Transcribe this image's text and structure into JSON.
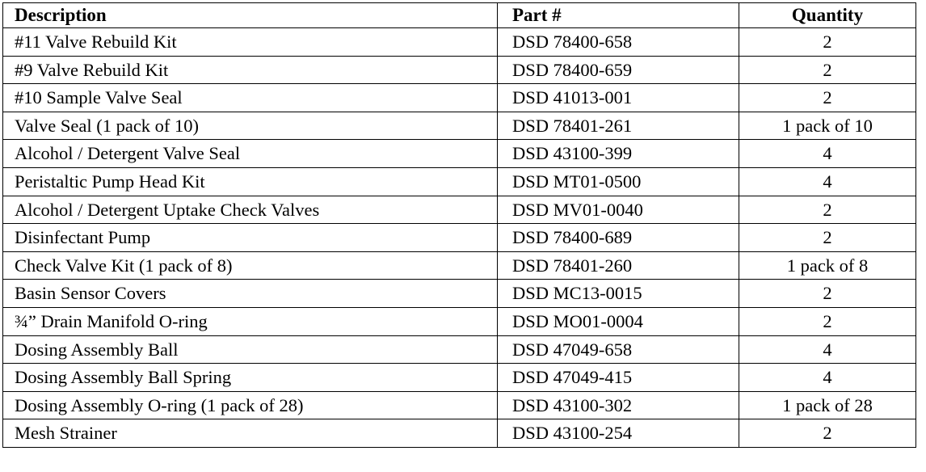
{
  "table": {
    "columns": [
      {
        "key": "description",
        "label": "Description",
        "align": "left"
      },
      {
        "key": "part_number",
        "label": "Part #",
        "align": "left"
      },
      {
        "key": "quantity",
        "label": "Quantity",
        "align": "center"
      }
    ],
    "rows": [
      {
        "description": "#11 Valve Rebuild Kit",
        "part_number": "DSD 78400-658",
        "quantity": "2"
      },
      {
        "description": "#9 Valve Rebuild Kit",
        "part_number": "DSD 78400-659",
        "quantity": "2"
      },
      {
        "description": "#10 Sample Valve Seal",
        "part_number": "DSD 41013-001",
        "quantity": "2"
      },
      {
        "description": "Valve Seal (1 pack of 10)",
        "part_number": "DSD 78401-261",
        "quantity": "1 pack of 10"
      },
      {
        "description": "Alcohol / Detergent Valve Seal",
        "part_number": "DSD 43100-399",
        "quantity": "4"
      },
      {
        "description": "Peristaltic Pump Head Kit",
        "part_number": "DSD MT01-0500",
        "quantity": "4"
      },
      {
        "description": "Alcohol / Detergent Uptake Check Valves",
        "part_number": "DSD MV01-0040",
        "quantity": "2"
      },
      {
        "description": "Disinfectant Pump",
        "part_number": "DSD 78400-689",
        "quantity": "2"
      },
      {
        "description": "Check Valve Kit (1 pack of 8)",
        "part_number": "DSD 78401-260",
        "quantity": "1 pack of 8"
      },
      {
        "description": "Basin Sensor Covers",
        "part_number": "DSD MC13-0015",
        "quantity": "2"
      },
      {
        "description": "¾” Drain Manifold O-ring",
        "part_number": "DSD MO01-0004",
        "quantity": "2"
      },
      {
        "description": "Dosing Assembly Ball",
        "part_number": "DSD 47049-658",
        "quantity": "4"
      },
      {
        "description": "Dosing Assembly Ball Spring",
        "part_number": "DSD 47049-415",
        "quantity": "4"
      },
      {
        "description": "Dosing Assembly O-ring (1 pack of 28)",
        "part_number": "DSD 43100-302",
        "quantity": "1 pack of 28"
      },
      {
        "description": "Mesh Strainer",
        "part_number": "DSD 43100-254",
        "quantity": "2"
      }
    ]
  },
  "colors": {
    "border": "#000000",
    "text": "#000000",
    "background": "#ffffff"
  }
}
